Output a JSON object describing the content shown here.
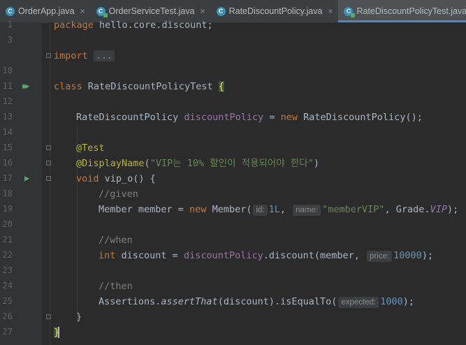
{
  "tabs": [
    {
      "label": "OrderApp.java",
      "icon": "java-class-icon",
      "active": false
    },
    {
      "label": "OrderServiceTest.java",
      "icon": "java-test-class-icon",
      "active": false
    },
    {
      "label": "RateDiscountPolicy.java",
      "icon": "java-class-icon",
      "active": false
    },
    {
      "label": "RateDiscountPolicyTest.java",
      "icon": "java-test-class-icon",
      "active": true
    }
  ],
  "close_glyph": "×",
  "line_numbers": [
    "1",
    "3",
    "10",
    "11",
    "12",
    "13",
    "14",
    "15",
    "16",
    "17",
    "18",
    "19",
    "20",
    "21",
    "22",
    "23",
    "24",
    "25",
    "26",
    "27"
  ],
  "code": {
    "l1_package": "package",
    "l1_name": " hello.core.discount;",
    "l3_import": "import",
    "l3_folded": "...",
    "l11_class": "class",
    "l11_name": " RateDiscountPolicyTest ",
    "l11_brace": "{",
    "l13_type": "RateDiscountPolicy ",
    "l13_field": "discountPolicy",
    "l13_eq": " = ",
    "l13_new": "new",
    "l13_ctor": " RateDiscountPolicy();",
    "l15_ann": "@Test",
    "l16_ann": "@DisplayName",
    "l16_open": "(",
    "l16_str": "\"VIP는 10% 할인이 적용되어야 한다\"",
    "l16_close": ")",
    "l17_void": "void",
    "l17_sig": " vip_o() {",
    "l18_cmt": "//given",
    "l19_a": "Member member = ",
    "l19_new": "new",
    "l19_b": " Member(",
    "l19_hint1": "id:",
    "l19_num": "1L",
    "l19_c": ", ",
    "l19_hint2": "name:",
    "l19_str": "\"memberVIP\"",
    "l19_d": ", Grade.",
    "l19_vip": "VIP",
    "l19_e": ");",
    "l21_cmt": "//when",
    "l22_int": "int",
    "l22_a": " discount = ",
    "l22_field": "discountPolicy",
    "l22_b": ".discount(member, ",
    "l22_hint": "price:",
    "l22_num": "10000",
    "l22_c": ");",
    "l24_cmt": "//then",
    "l25_a": "Assertions.",
    "l25_method": "assertThat",
    "l25_b": "(discount).isEqualTo(",
    "l25_hint": "expected:",
    "l25_num": "1000",
    "l25_c": ");",
    "l26_brace": "}",
    "l27_brace": "}"
  }
}
